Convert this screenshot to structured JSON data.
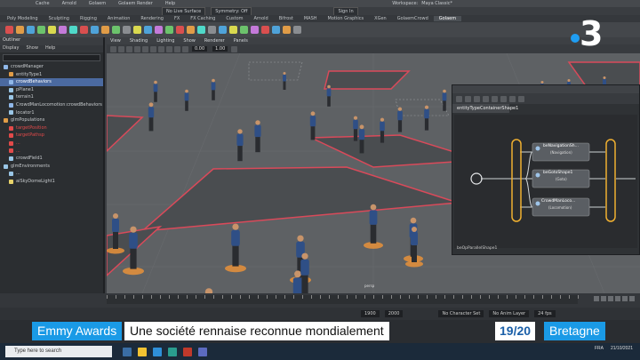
{
  "maya": {
    "menubar": [
      "Cache",
      "Arnold",
      "Golaem",
      "Golaem Render",
      "Help"
    ],
    "workspace": {
      "label": "Workspace:",
      "value": "Maya Classic*"
    },
    "toolbar": {
      "no_live": "No Live Surface",
      "symmetry": "Symmetry: Off",
      "sign_in": "Sign In"
    },
    "shelf_tabs": [
      "Poly Modeling",
      "Sculpting",
      "Rigging",
      "Animation",
      "Rendering",
      "FX",
      "FX Caching",
      "Custom",
      "Arnold",
      "Bifrost",
      "MASH",
      "Motion Graphics",
      "XGen",
      "GolaemCrowd",
      "Golaem"
    ],
    "outliner": {
      "title": "Outliner",
      "menus": [
        "Display",
        "Show",
        "Help"
      ],
      "items": [
        {
          "label": "crowdManager",
          "color": "#8fb7e8",
          "state": "normal"
        },
        {
          "label": "entityType1",
          "color": "#e09c47",
          "state": "normal"
        },
        {
          "label": "crowdBehaviors",
          "color": "#8fb7e8",
          "state": "selected"
        },
        {
          "label": "pPlane1",
          "color": "#9ac6e6",
          "state": "normal"
        },
        {
          "label": "terrain1",
          "color": "#9ac6e6",
          "state": "normal"
        },
        {
          "label": "CrowdManLocomotion:crowdBehaviors",
          "color": "#8fb7e8",
          "state": "normal"
        },
        {
          "label": "locator1",
          "color": "#9ac6e6",
          "state": "normal"
        },
        {
          "label": "glmPopulations",
          "color": "#e09c47",
          "state": "normal"
        },
        {
          "label": "targetPosition",
          "color": "#e24a4a",
          "state": "red"
        },
        {
          "label": "targetPathsp",
          "color": "#e24a4a",
          "state": "red"
        },
        {
          "label": "...",
          "color": "#e24a4a",
          "state": "red"
        },
        {
          "label": "...",
          "color": "#e24a4a",
          "state": "red"
        },
        {
          "label": "crowdField1",
          "color": "#9ac6e6",
          "state": "normal"
        },
        {
          "label": "glmEnvironments",
          "color": "#9ac6e6",
          "state": "normal"
        },
        {
          "label": "...",
          "color": "#9ac6e6",
          "state": "normal"
        },
        {
          "label": "aiSkyDomeLight1",
          "color": "#e8d36a",
          "state": "normal"
        }
      ]
    },
    "viewport": {
      "menus": [
        "View",
        "Shading",
        "Lighting",
        "Show",
        "Renderer",
        "Panels"
      ],
      "field1": "0.00",
      "field2": "1.00",
      "camera": "persp"
    },
    "node_editor": {
      "tab": "entityTypeContainerShape1",
      "nodes": [
        {
          "name": "beNavigationSh...",
          "sub": "(Navigation)"
        },
        {
          "name": "beGotoShape1",
          "sub": "(Goto)"
        },
        {
          "name": "CrowdManLoco...",
          "sub": "(Locomotion)"
        }
      ],
      "footer": "beOpParallelShape1"
    },
    "range": {
      "start": "1900",
      "end": "2000",
      "char_set": "No Character Set",
      "anim_layer": "No Anim Layer",
      "fps": "24 fps"
    }
  },
  "broadcast": {
    "channel_digit": "3",
    "category": "Emmy Awards",
    "headline": "Une société rennaise reconnue mondialement",
    "show": "19/20",
    "region": "Bretagne"
  },
  "taskbar": {
    "search_placeholder": "Type here to search",
    "lang": "FRA",
    "date": "21/10/2021"
  }
}
